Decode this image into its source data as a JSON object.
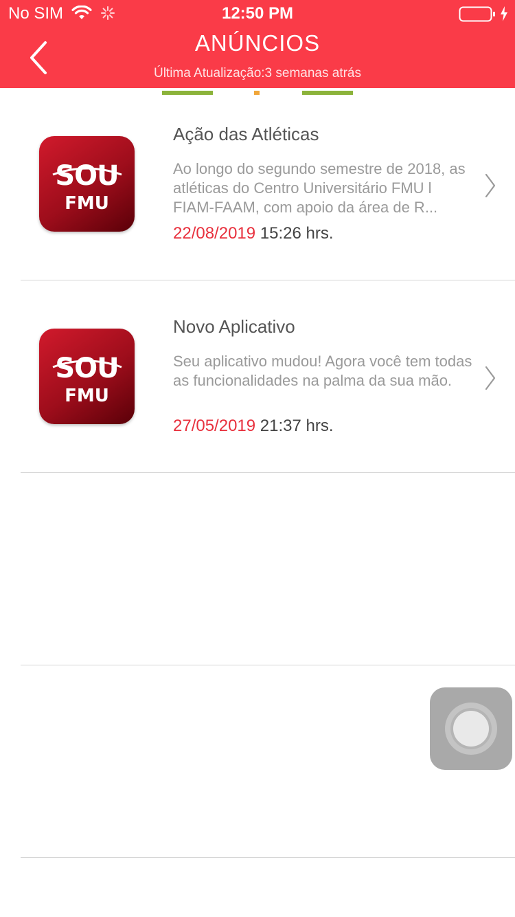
{
  "status_bar": {
    "carrier": "No SIM",
    "time": "12:50 PM"
  },
  "header": {
    "title": "ANÚNCIOS",
    "subtitle": "Última Atualização:3 semanas atrás",
    "background_color": "#fa3b48"
  },
  "announcements": [
    {
      "logo_top": "SOU",
      "logo_bottom": "FMU",
      "title": "Ação das Atléticas",
      "description": "Ao longo do segundo semestre de 2018, as atléticas do Centro Universitário FMU l FIAM-FAAM, com apoio da área de R...",
      "date": "22/08/2019",
      "time": "15:26 hrs."
    },
    {
      "logo_top": "SOU",
      "logo_bottom": "FMU",
      "title": "Novo Aplicativo",
      "description": "Seu aplicativo mudou! Agora você tem todas as funcionalidades na palma da sua mão.",
      "date": "27/05/2019",
      "time": "21:37 hrs."
    }
  ],
  "colors": {
    "date": "#e8303d",
    "tab_indicator": "#8bb33a"
  }
}
